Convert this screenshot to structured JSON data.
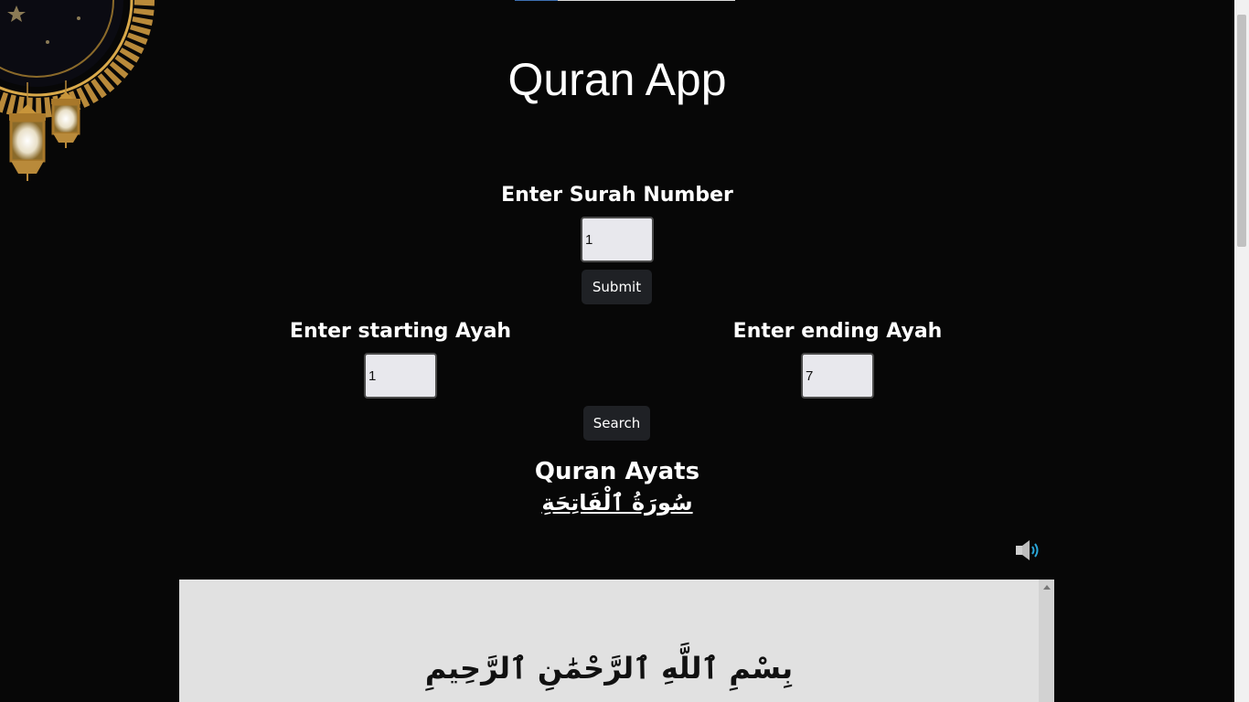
{
  "app": {
    "title": "Quran App"
  },
  "surah_form": {
    "label": "Enter Surah Number",
    "value": "1",
    "submit_label": "Submit"
  },
  "ayah_form": {
    "start_label": "Enter starting Ayah",
    "start_value": "1",
    "end_label": "Enter ending Ayah",
    "end_value": "7",
    "search_label": "Search"
  },
  "results": {
    "heading": "Quran Ayats",
    "surah_name": "سُورَةُ ٱلْفَاتِحَةِ",
    "audio_icon": "speaker-icon",
    "ayat": [
      "بِسْمِ ٱللَّهِ ٱلرَّحْمَٰنِ ٱلرَّحِيمِ"
    ]
  },
  "colors": {
    "background": "#070707",
    "button": "#1f2125",
    "input": "#e8e8ed",
    "panel": "#e1e1e1",
    "gold": "#c8953a",
    "speaker_accent": "#2aa6d8"
  }
}
